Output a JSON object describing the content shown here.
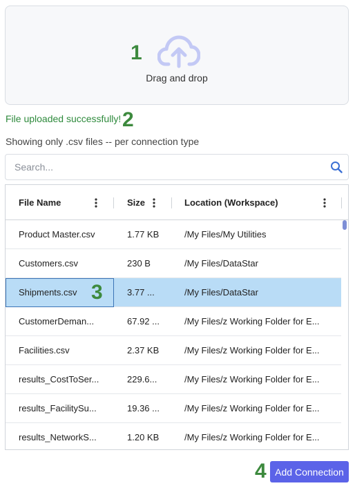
{
  "dropzone": {
    "text": "Drag and drop",
    "icon": "cloud-upload-icon"
  },
  "markers": {
    "m1": "1",
    "m2": "2",
    "m3": "3",
    "m4": "4"
  },
  "status": {
    "success": "File uploaded successfully!",
    "hint": "Showing only .csv files -- per connection type"
  },
  "search": {
    "placeholder": "Search...",
    "value": ""
  },
  "table": {
    "columns": [
      "File Name",
      "Size",
      "Location (Workspace)"
    ],
    "rows": [
      {
        "name": "Product Master.csv",
        "size": "1.77 KB",
        "location": "/My Files/My Utilities"
      },
      {
        "name": "Customers.csv",
        "size": "230 B",
        "location": "/My Files/DataStar"
      },
      {
        "name": "Shipments.csv",
        "size": "3.77 ...",
        "location": "/My Files/DataStar",
        "selected": true
      },
      {
        "name": "CustomerDeman...",
        "size": "67.92 ...",
        "location": "/My Files/z Working Folder for E..."
      },
      {
        "name": "Facilities.csv",
        "size": "2.37 KB",
        "location": "/My Files/z Working Folder for E..."
      },
      {
        "name": "results_CostToSer...",
        "size": "229.6...",
        "location": "/My Files/z Working Folder for E..."
      },
      {
        "name": "results_FacilitySu...",
        "size": "19.36 ...",
        "location": "/My Files/z Working Folder for E..."
      },
      {
        "name": "results_NetworkS...",
        "size": "1.20 KB",
        "location": "/My Files/z Working Folder for E..."
      }
    ]
  },
  "actions": {
    "add_connection": "Add Connection"
  },
  "colors": {
    "accent": "#5b63e8",
    "success": "#2e8a3c",
    "marker": "#3d8a3e",
    "selected_row": "#b9dcf6"
  }
}
